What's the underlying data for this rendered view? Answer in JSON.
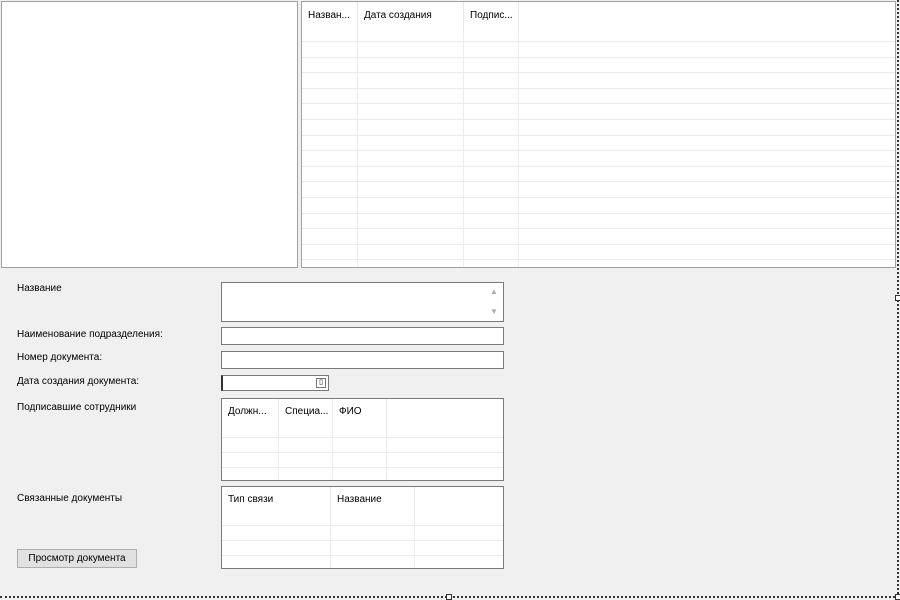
{
  "documents_grid": {
    "columns": [
      "Назван...",
      "Дата создания",
      "Подпис..."
    ]
  },
  "form": {
    "name_label": "Название",
    "department_label": "Наименование подразделения:",
    "doc_number_label": "Номер документа:",
    "created_date_label": "Дата создания документа:",
    "signers_label": "Подписавшие сотрудники",
    "related_label": "Связанные документы",
    "name_value": "",
    "department_value": "",
    "doc_number_value": "",
    "created_date_value": ""
  },
  "signers_grid": {
    "columns": [
      "Должн...",
      "Специа...",
      "ФИО"
    ]
  },
  "related_grid": {
    "columns": [
      "Тип связи",
      "Название"
    ]
  },
  "view_button_label": "Просмотр документа",
  "icons": {
    "scroll_up": "▲",
    "scroll_down": "▼",
    "calendar": "▯"
  }
}
